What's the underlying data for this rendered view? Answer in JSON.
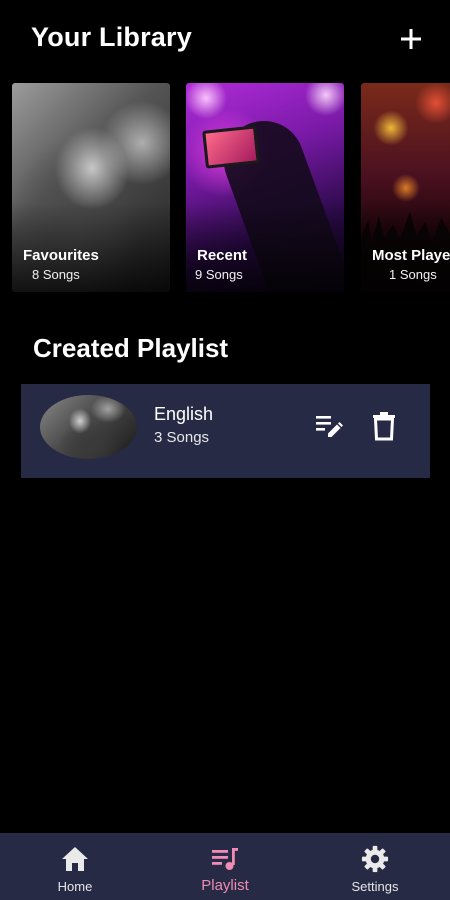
{
  "header": {
    "title": "Your Library",
    "add_icon": "plus-icon"
  },
  "library_cards": [
    {
      "name": "Favourites",
      "count": "8 Songs"
    },
    {
      "name": "Recent",
      "count": "9 Songs"
    },
    {
      "name": "Most Played",
      "count": "1 Songs"
    }
  ],
  "created": {
    "title": "Created Playlist",
    "items": [
      {
        "name": "English",
        "count": "3 Songs",
        "edit_icon": "playlist-edit-icon",
        "delete_icon": "trash-icon"
      }
    ]
  },
  "nav": {
    "items": [
      {
        "label": "Home",
        "icon": "home-icon",
        "active": false
      },
      {
        "label": "Playlist",
        "icon": "playlist-music-icon",
        "active": true
      },
      {
        "label": "Settings",
        "icon": "gear-icon",
        "active": false
      }
    ],
    "active_color": "#f08cb4"
  },
  "colors": {
    "background": "#000000",
    "panel": "#262a44",
    "accent": "#f08cb4"
  }
}
